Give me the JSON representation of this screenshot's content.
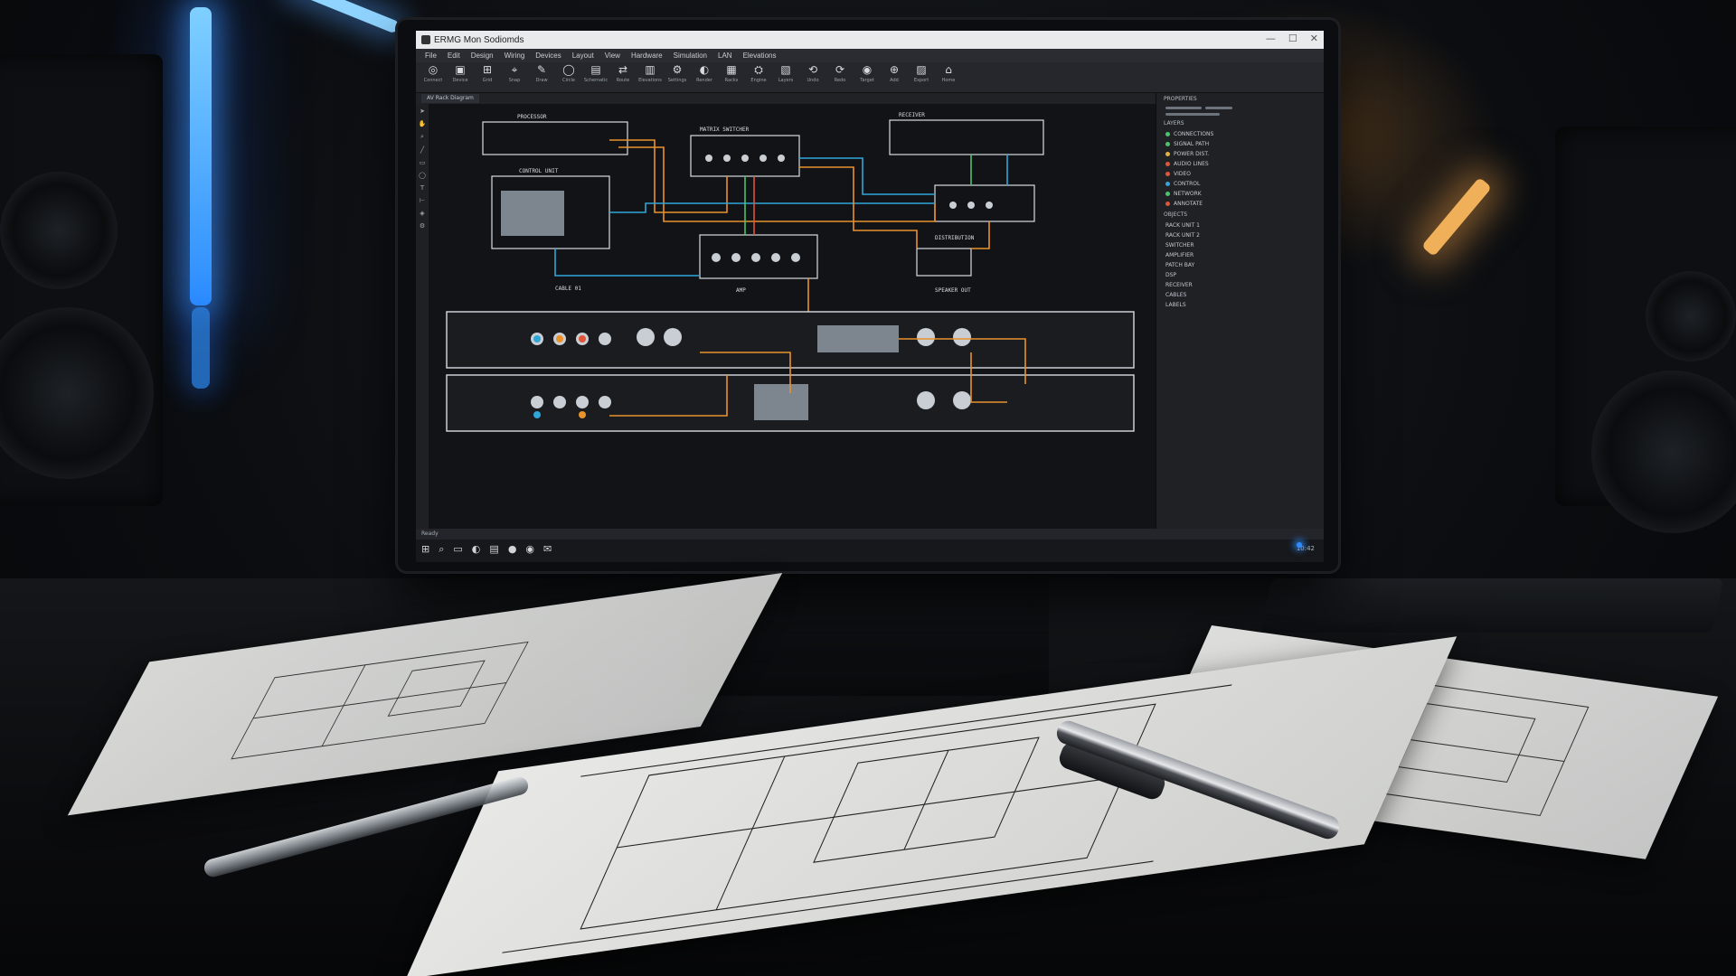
{
  "window": {
    "title": "ERMG Mon Sodiomds",
    "controls": [
      "—",
      "☐",
      "✕"
    ]
  },
  "menu": [
    "File",
    "Edit",
    "Design",
    "Wiring",
    "Devices",
    "Layout",
    "View",
    "Hardware",
    "Simulation",
    "LAN",
    "Elevations"
  ],
  "toolbar": [
    {
      "glyph": "◎",
      "label": "Connect"
    },
    {
      "glyph": "▣",
      "label": "Device"
    },
    {
      "glyph": "⊞",
      "label": "Grid"
    },
    {
      "glyph": "⌖",
      "label": "Snap"
    },
    {
      "glyph": "✎",
      "label": "Draw"
    },
    {
      "glyph": "◯",
      "label": "Circle"
    },
    {
      "glyph": "▤",
      "label": "Schematic"
    },
    {
      "glyph": "⇄",
      "label": "Route"
    },
    {
      "glyph": "▥",
      "label": "Elevations"
    },
    {
      "glyph": "⚙",
      "label": "Settings"
    },
    {
      "glyph": "◐",
      "label": "Render"
    },
    {
      "glyph": "▦",
      "label": "Racks"
    },
    {
      "glyph": "⛭",
      "label": "Engine"
    },
    {
      "glyph": "▧",
      "label": "Layers"
    },
    {
      "glyph": "⟲",
      "label": "Undo"
    },
    {
      "glyph": "⟳",
      "label": "Redo"
    },
    {
      "glyph": "◉",
      "label": "Target"
    },
    {
      "glyph": "⊕",
      "label": "Add"
    },
    {
      "glyph": "▨",
      "label": "Export"
    },
    {
      "glyph": "⌂",
      "label": "Home"
    }
  ],
  "document_tab": "AV Rack Diagram",
  "schematic_labels": {
    "device_a": "PROCESSOR",
    "device_b": "CONTROL UNIT",
    "device_c": "MATRIX SWITCHER",
    "device_d": "AMP",
    "device_e": "DISTRIBUTION",
    "device_f": "RECEIVER",
    "label_g": "CABLE 01",
    "label_h": "SPEAKER OUT"
  },
  "side_panel": {
    "title": "PROPERTIES",
    "layers_title": "LAYERS",
    "layers": [
      {
        "name": "CONNECTIONS",
        "color": "#4cc36a"
      },
      {
        "name": "SIGNAL PATH",
        "color": "#4cc36a"
      },
      {
        "name": "POWER DIST.",
        "color": "#e0b340"
      },
      {
        "name": "AUDIO LINES",
        "color": "#e0543a"
      },
      {
        "name": "VIDEO",
        "color": "#e0543a"
      },
      {
        "name": "CONTROL",
        "color": "#3aa0e0"
      },
      {
        "name": "NETWORK",
        "color": "#4cc36a"
      },
      {
        "name": "ANNOTATE",
        "color": "#e0543a"
      }
    ],
    "section_title": "OBJECTS",
    "objects": [
      "RACK UNIT 1",
      "RACK UNIT 2",
      "SWITCHER",
      "AMPLIFIER",
      "PATCH BAY",
      "DSP",
      "RECEIVER",
      "CABLES",
      "LABELS"
    ]
  },
  "status_text": "Ready",
  "tray_text": "10:42"
}
